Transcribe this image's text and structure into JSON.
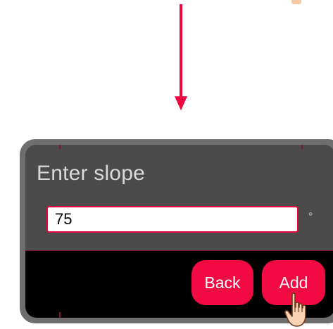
{
  "tutorial": {
    "arrow_color": "#f0063f"
  },
  "dialog": {
    "title": "Enter slope",
    "slope_value": "75",
    "unit": "°",
    "back_label": "Back",
    "add_label": "Add",
    "accent_color": "#f20a43"
  },
  "cursor": {
    "icon": "pointing-hand-icon"
  }
}
